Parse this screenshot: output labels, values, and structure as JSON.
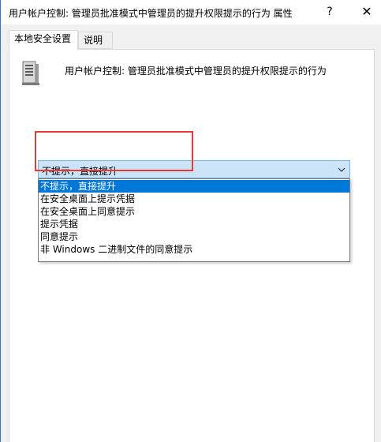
{
  "window": {
    "title": "用户帐户控制: 管理员批准模式中管理员的提升权限提示的行为 属性",
    "help_label": "?",
    "close_label": "✕"
  },
  "tabs": [
    {
      "label": "本地安全设置",
      "active": true
    },
    {
      "label": "说明",
      "active": false
    }
  ],
  "policy": {
    "name": "用户帐户控制: 管理员批准模式中管理员的提升权限提示的行为",
    "icon": "server-computer-icon"
  },
  "combo": {
    "selected_value": "不提示，直接提升",
    "arrow_icon": "chevron-down-icon"
  },
  "dropdown": {
    "options": [
      {
        "label": "不提示，直接提升",
        "selected": true
      },
      {
        "label": "在安全桌面上提示凭据",
        "selected": false
      },
      {
        "label": "在安全桌面上同意提示",
        "selected": false
      },
      {
        "label": "提示凭据",
        "selected": false
      },
      {
        "label": "同意提示",
        "selected": false
      },
      {
        "label": "非 Windows 二进制文件的同意提示",
        "selected": false
      }
    ]
  },
  "colors": {
    "selection": "#0078d7",
    "combo_bg": "#cce4f7",
    "annotation": "#e83a3a",
    "window_border": "#2b79d0"
  }
}
